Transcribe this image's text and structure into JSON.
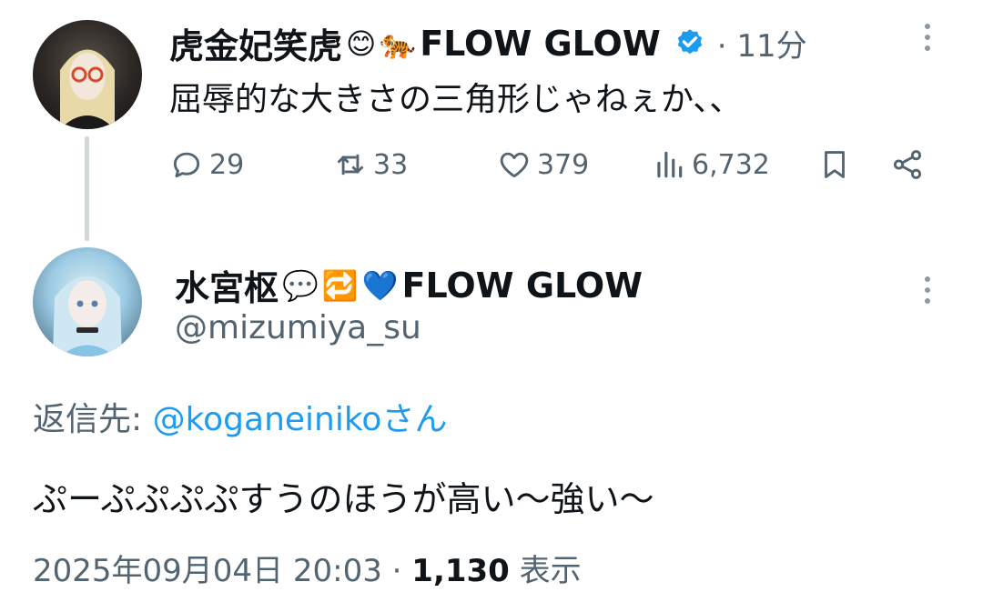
{
  "tweet1": {
    "display_name": "虎金妃笑虎",
    "name_emoji_1": "😊",
    "name_emoji_2": "🐅",
    "name_suffix": "FLOW GLOW",
    "time": "· 11分",
    "text": "屈辱的な大きさの三角形じゃねぇか、、",
    "actions": {
      "replies": "29",
      "reposts": "33",
      "likes": "379",
      "views": "6,732"
    }
  },
  "tweet2": {
    "display_name": "水宮枢",
    "name_emoji_1": "💬",
    "name_emoji_2": "🔁",
    "name_emoji_3": "💙",
    "name_suffix": "FLOW GLOW",
    "handle": "@mizumiya_su",
    "reply_to_label": "返信先: ",
    "reply_to_user": "@koganeinikoさん",
    "text": "ぷーぷぷぷぷすうのほうが高い～強い～",
    "timestamp": "2025年09月04日 20:03 · ",
    "view_count": "1,130",
    "view_label": " 表示"
  },
  "colors": {
    "accent": "#1d9bf0",
    "muted": "#536471",
    "text": "#0f1419",
    "thread_line": "#cfd9de"
  }
}
